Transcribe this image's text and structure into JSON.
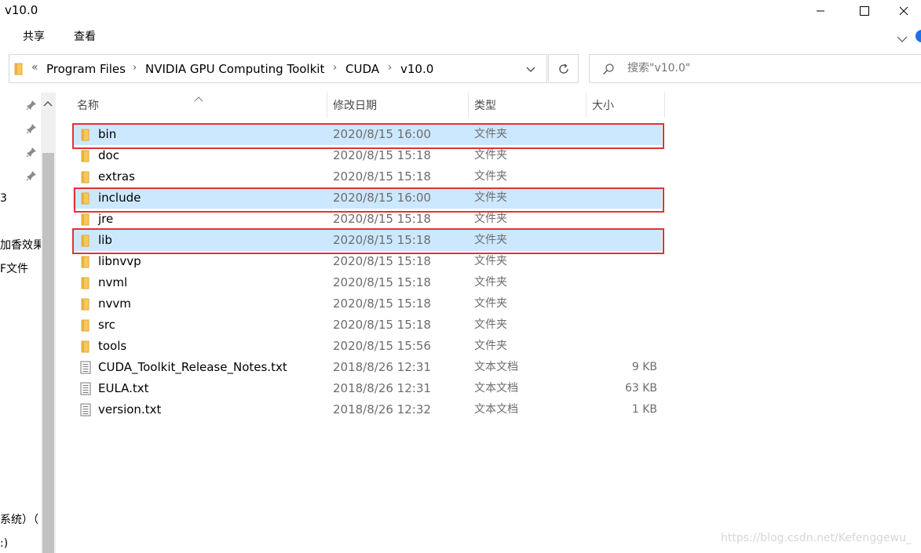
{
  "window": {
    "title": "v10.0"
  },
  "ribbon": {
    "tabs": [
      "共享",
      "查看"
    ]
  },
  "address_bar": {
    "overflow": "«",
    "breadcrumbs": [
      "Program Files",
      "NVIDIA GPU Computing Toolkit",
      "CUDA",
      "v10.0"
    ]
  },
  "search": {
    "placeholder": "搜索\"v10.0\""
  },
  "nav": {
    "labels": [
      "3",
      "加香效果",
      "F文件",
      "系统）（",
      ":)"
    ]
  },
  "columns": {
    "name": "名称",
    "date": "修改日期",
    "type": "类型",
    "size": "大小"
  },
  "files": [
    {
      "name": "bin",
      "date": "2020/8/15 16:00",
      "type": "文件夹",
      "size": "",
      "kind": "folder",
      "selected": true
    },
    {
      "name": "doc",
      "date": "2020/8/15 15:18",
      "type": "文件夹",
      "size": "",
      "kind": "folder",
      "selected": false
    },
    {
      "name": "extras",
      "date": "2020/8/15 15:18",
      "type": "文件夹",
      "size": "",
      "kind": "folder",
      "selected": false
    },
    {
      "name": "include",
      "date": "2020/8/15 16:00",
      "type": "文件夹",
      "size": "",
      "kind": "folder",
      "selected": true
    },
    {
      "name": "jre",
      "date": "2020/8/15 15:18",
      "type": "文件夹",
      "size": "",
      "kind": "folder",
      "selected": false
    },
    {
      "name": "lib",
      "date": "2020/8/15 15:18",
      "type": "文件夹",
      "size": "",
      "kind": "folder",
      "selected": true
    },
    {
      "name": "libnvvp",
      "date": "2020/8/15 15:18",
      "type": "文件夹",
      "size": "",
      "kind": "folder",
      "selected": false
    },
    {
      "name": "nvml",
      "date": "2020/8/15 15:18",
      "type": "文件夹",
      "size": "",
      "kind": "folder",
      "selected": false
    },
    {
      "name": "nvvm",
      "date": "2020/8/15 15:18",
      "type": "文件夹",
      "size": "",
      "kind": "folder",
      "selected": false
    },
    {
      "name": "src",
      "date": "2020/8/15 15:18",
      "type": "文件夹",
      "size": "",
      "kind": "folder",
      "selected": false
    },
    {
      "name": "tools",
      "date": "2020/8/15 15:56",
      "type": "文件夹",
      "size": "",
      "kind": "folder",
      "selected": false
    },
    {
      "name": "CUDA_Toolkit_Release_Notes.txt",
      "date": "2018/8/26 12:31",
      "type": "文本文档",
      "size": "9 KB",
      "kind": "text",
      "selected": false
    },
    {
      "name": "EULA.txt",
      "date": "2018/8/26 12:31",
      "type": "文本文档",
      "size": "63 KB",
      "kind": "text",
      "selected": false
    },
    {
      "name": "version.txt",
      "date": "2018/8/26 12:32",
      "type": "文本文档",
      "size": "1 KB",
      "kind": "text",
      "selected": false
    }
  ],
  "watermark": "https://blog.csdn.net/Kefenggewu_",
  "colors": {
    "selection": "#cce8ff",
    "highlight_border": "#e0323a",
    "folder": "#f7c95c"
  }
}
